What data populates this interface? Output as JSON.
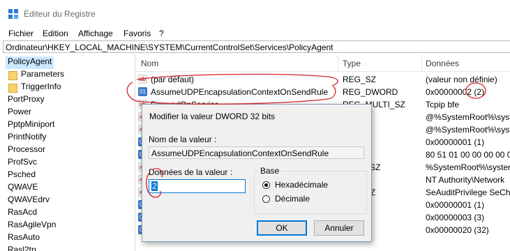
{
  "window": {
    "title": "Éditeur du Registre"
  },
  "menu": [
    "Fichier",
    "Edition",
    "Affichage",
    "Favoris",
    "?"
  ],
  "address": "Ordinateur\\HKEY_LOCAL_MACHINE\\SYSTEM\\CurrentControlSet\\Services\\PolicyAgent",
  "tree": {
    "selected": "PolicyAgent",
    "children": [
      "Parameters",
      "TriggerInfo"
    ],
    "siblings": [
      "PortProxy",
      "Power",
      "PptpMiniport",
      "PrintNotify",
      "Processor",
      "ProfSvc",
      "Psched",
      "QWAVE",
      "QWAVEdrv",
      "RasAcd",
      "RasAgileVpn",
      "RasAuto",
      "Rasl2tp"
    ]
  },
  "list": {
    "headers": {
      "name": "Nom",
      "type": "Type",
      "data": "Données"
    },
    "rows": [
      {
        "name": "(par défaut)",
        "type": "REG_SZ",
        "data": "(valeur non définie)"
      },
      {
        "name": "AssumeUDPEncapsulationContextOnSendRule",
        "type": "REG_DWORD",
        "data": "0x00000002 (2)"
      },
      {
        "name": "DependOnService",
        "type": "REG_MULTI_SZ",
        "data": "Tcpip bfe"
      },
      {
        "name": "",
        "type": "",
        "data": "@%SystemRoot%\\syster"
      },
      {
        "name": "",
        "type": "",
        "data": "@%SystemRoot%\\syster"
      },
      {
        "name": "",
        "type": "",
        "data": "0x00000001 (1)"
      },
      {
        "name": "",
        "type": "NARY",
        "data": "80 51 01 00 00 00 00 00"
      },
      {
        "name": "",
        "type": "PAND_SZ",
        "data": "%SystemRoot%\\systen"
      },
      {
        "name": "",
        "type": "",
        "data": "NT Authority\\Network"
      },
      {
        "name": "",
        "type": "ULTI_SZ",
        "data": "SeAuditPrivilege SeCha"
      },
      {
        "name": "",
        "type": "WORD",
        "data": "0x00000001 (1)"
      },
      {
        "name": "",
        "type": "WORD",
        "data": "0x00000003 (3)"
      },
      {
        "name": "",
        "type": "WORD",
        "data": "0x00000020 (32)"
      }
    ]
  },
  "dialog": {
    "title": "Modifier la valeur DWORD 32 bits",
    "name_label": "Nom de la valeur :",
    "name_value": "AssumeUDPEncapsulationContextOnSendRule",
    "data_label": "Données de la valeur :",
    "data_value": "2",
    "base_label": "Base",
    "radio_hex": "Hexadécimale",
    "radio_dec": "Décimale",
    "ok": "OK",
    "cancel": "Annuler"
  },
  "colors": {
    "selection": "#cce8ff",
    "accent": "#0078d7",
    "annotation": "#d2232a"
  }
}
